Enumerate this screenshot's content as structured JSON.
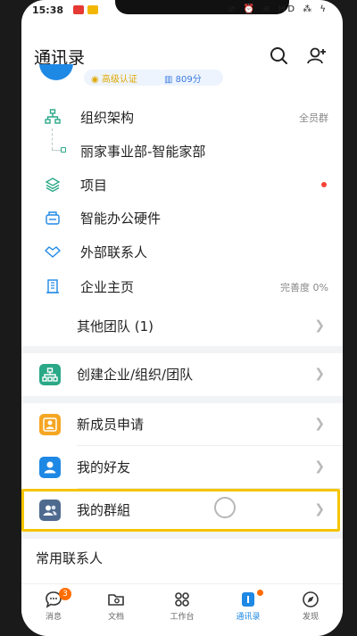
{
  "status_bar": {
    "time": "15:38",
    "icons": "⊘ ⏰ ≋ HD ⁂ ϟ"
  },
  "header": {
    "title": "通讯录"
  },
  "profile": {
    "cert_badge": "◉ 高级认证",
    "score_badge": "▥ 809分"
  },
  "org": {
    "structure_label": "组织架构",
    "structure_meta": "全员群",
    "dept_label": "丽家事业部-智能家部",
    "project_label": "项目",
    "hardware_label": "智能办公硬件",
    "external_label": "外部联系人",
    "homepage_label": "企业主页",
    "homepage_meta": "完善度 0%"
  },
  "other_teams": {
    "label": "其他团队 (1)"
  },
  "actions": {
    "create_label": "创建企业/组织/团队",
    "new_member_label": "新成员申请",
    "friends_label": "我的好友",
    "groups_label": "我的群組"
  },
  "frequent_contacts": {
    "title": "常用联系人"
  },
  "tabbar": {
    "messages": {
      "label": "消息",
      "count": "3"
    },
    "docs": {
      "label": "文档"
    },
    "workbench": {
      "label": "工作台"
    },
    "contacts": {
      "label": "通讯录"
    },
    "discover": {
      "label": "发现"
    }
  },
  "colors": {
    "accent": "#1e88e5",
    "green": "#2aa887",
    "orange": "#f5a623",
    "highlight": "#f5c400"
  }
}
